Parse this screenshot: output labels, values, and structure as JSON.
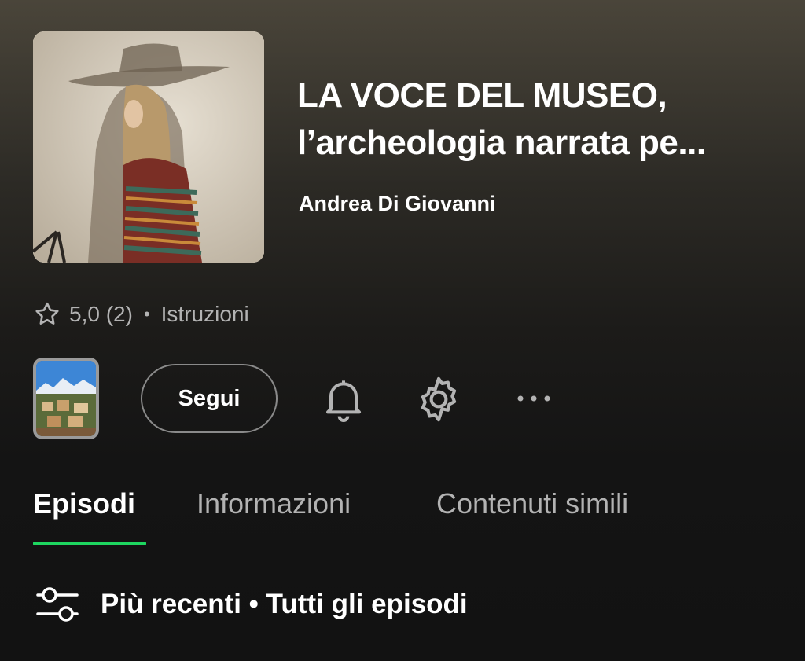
{
  "podcast": {
    "title_line1": "LA VOCE DEL MUSEO,",
    "title_line2": "l’archeologia narrata pe...",
    "author": "Andrea Di Giovanni",
    "cover_icon": "podcast-cover-artwork"
  },
  "meta": {
    "rating": "5,0 (2)",
    "separator": "•",
    "instructions_label": "Istruzioni"
  },
  "actions": {
    "follow_label": "Segui",
    "icons": [
      "bell-icon",
      "gear-icon",
      "more-icon"
    ]
  },
  "tabs": [
    {
      "label": "Episodi",
      "active": true
    },
    {
      "label": "Informazioni",
      "active": false
    },
    {
      "label": "Contenuti simili",
      "active": false
    }
  ],
  "sort": {
    "label": "Più recenti • Tutti gli episodi"
  },
  "colors": {
    "accent": "#1ed760",
    "text_secondary": "#b3b3b3",
    "background": "#121212"
  }
}
